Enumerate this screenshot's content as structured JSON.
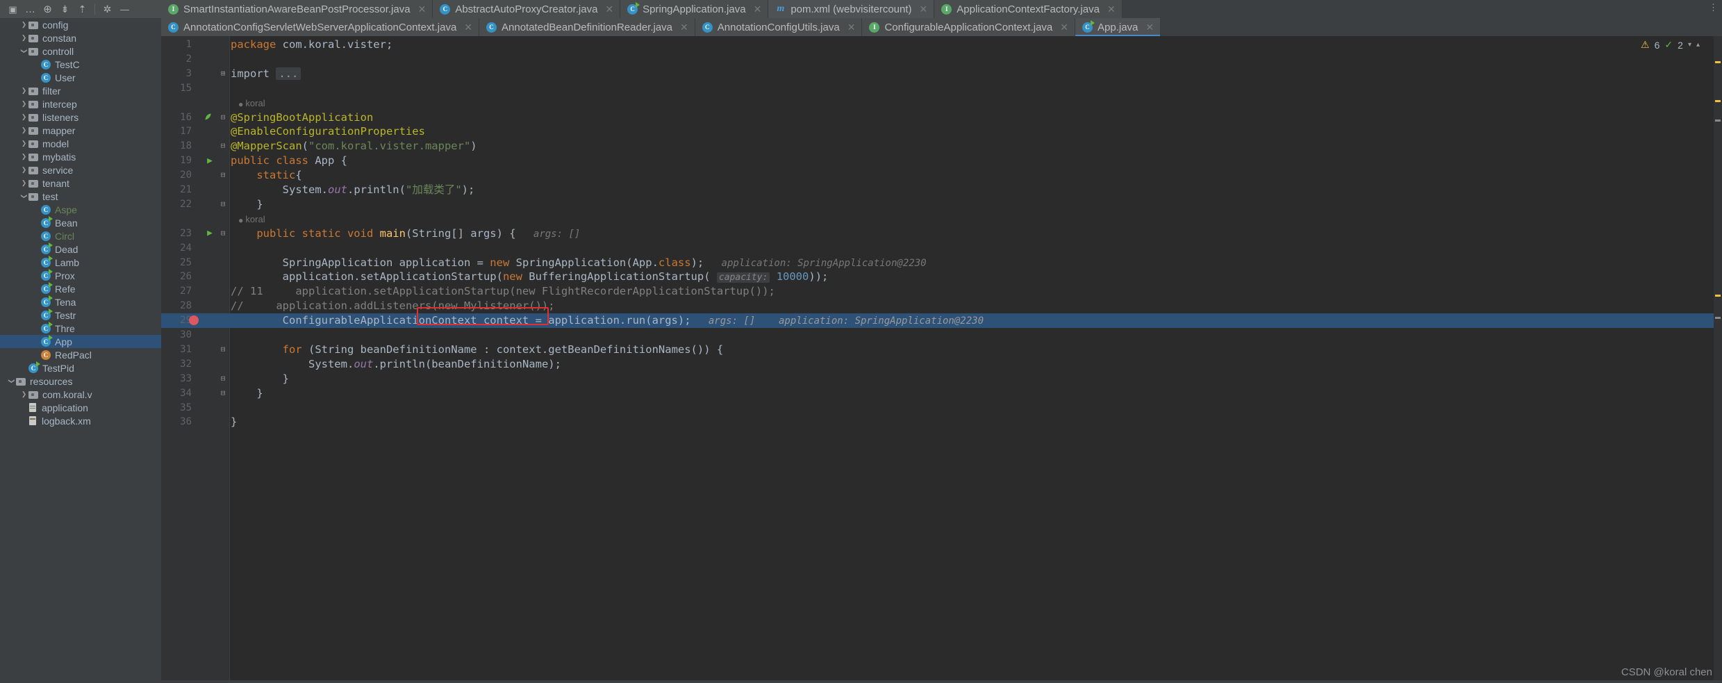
{
  "toolbar": {
    "icons": [
      {
        "name": "project-view-icon",
        "glyph": "▣"
      },
      {
        "name": "more-options-icon",
        "glyph": "…"
      },
      {
        "name": "locate-file-icon",
        "glyph": "⊕"
      },
      {
        "name": "expand-all-icon",
        "glyph": "⇟"
      },
      {
        "name": "collapse-all-icon",
        "glyph": "⇡"
      },
      {
        "name": "settings-gear-icon",
        "glyph": "✿"
      },
      {
        "name": "hide-panel-icon",
        "glyph": "—"
      }
    ]
  },
  "tabs_row1": [
    {
      "label": "SmartInstantiationAwareBeanPostProcessor.java",
      "icon": "interface",
      "state": "inactive"
    },
    {
      "label": "AbstractAutoProxyCreator.java",
      "icon": "class",
      "state": "inactive"
    },
    {
      "label": "SpringApplication.java",
      "icon": "class-runnable",
      "state": "inactive"
    },
    {
      "label": "pom.xml (webvisitercount)",
      "icon": "maven",
      "state": "active"
    },
    {
      "label": "ApplicationContextFactory.java",
      "icon": "interface",
      "state": "inactive"
    }
  ],
  "tabs_row2": [
    {
      "label": "AnnotationConfigServletWebServerApplicationContext.java",
      "icon": "class",
      "state": "inactive"
    },
    {
      "label": "AnnotatedBeanDefinitionReader.java",
      "icon": "class",
      "state": "inactive"
    },
    {
      "label": "AnnotationConfigUtils.java",
      "icon": "class",
      "state": "inactive"
    },
    {
      "label": "ConfigurableApplicationContext.java",
      "icon": "interface",
      "state": "inactive"
    },
    {
      "label": "App.java",
      "icon": "class-runnable",
      "state": "selected"
    }
  ],
  "tab_close_glyph": "✕",
  "tab_overflow_glyph": "⋮",
  "sidebar": {
    "items": [
      {
        "label": "config",
        "type": "folder",
        "arrow": "collapsed",
        "indent": 1
      },
      {
        "label": "constan",
        "type": "folder",
        "arrow": "collapsed",
        "indent": 1
      },
      {
        "label": "controll",
        "type": "folder",
        "arrow": "expanded",
        "indent": 1
      },
      {
        "label": "TestC",
        "type": "class",
        "arrow": "none",
        "indent": 2
      },
      {
        "label": "User",
        "type": "class",
        "arrow": "none",
        "indent": 2
      },
      {
        "label": "filter",
        "type": "folder",
        "arrow": "collapsed",
        "indent": 1
      },
      {
        "label": "intercep",
        "type": "folder",
        "arrow": "collapsed",
        "indent": 1
      },
      {
        "label": "listeners",
        "type": "folder",
        "arrow": "collapsed",
        "indent": 1
      },
      {
        "label": "mapper",
        "type": "folder",
        "arrow": "collapsed",
        "indent": 1
      },
      {
        "label": "model",
        "type": "folder",
        "arrow": "collapsed",
        "indent": 1
      },
      {
        "label": "mybatis",
        "type": "folder",
        "arrow": "collapsed",
        "indent": 1
      },
      {
        "label": "service",
        "type": "folder",
        "arrow": "collapsed",
        "indent": 1
      },
      {
        "label": "tenant",
        "type": "folder",
        "arrow": "collapsed",
        "indent": 1
      },
      {
        "label": "test",
        "type": "folder",
        "arrow": "expanded",
        "indent": 1
      },
      {
        "label": "Aspe",
        "type": "class",
        "arrow": "none",
        "indent": 2,
        "color": "green"
      },
      {
        "label": "Bean",
        "type": "class-runnable",
        "arrow": "none",
        "indent": 2
      },
      {
        "label": "Circl",
        "type": "class",
        "arrow": "none",
        "indent": 2,
        "color": "green"
      },
      {
        "label": "Dead",
        "type": "class-runnable",
        "arrow": "none",
        "indent": 2
      },
      {
        "label": "Lamb",
        "type": "class-runnable",
        "arrow": "none",
        "indent": 2
      },
      {
        "label": "Prox",
        "type": "class-runnable",
        "arrow": "none",
        "indent": 2
      },
      {
        "label": "Refe",
        "type": "class-runnable",
        "arrow": "none",
        "indent": 2
      },
      {
        "label": "Tena",
        "type": "class-runnable",
        "arrow": "none",
        "indent": 2
      },
      {
        "label": "Testr",
        "type": "class-runnable",
        "arrow": "none",
        "indent": 2
      },
      {
        "label": "Thre",
        "type": "class-runnable",
        "arrow": "none",
        "indent": 2
      },
      {
        "label": "App",
        "type": "class-runnable",
        "arrow": "none",
        "indent": 2,
        "selected": true
      },
      {
        "label": "RedPacl",
        "type": "class-other",
        "arrow": "none",
        "indent": 2
      },
      {
        "label": "TestPid",
        "type": "class-runnable",
        "arrow": "none",
        "indent": 1
      },
      {
        "label": "resources",
        "type": "folder-res",
        "arrow": "expanded",
        "indent": 0
      },
      {
        "label": "com.koral.v",
        "type": "folder",
        "arrow": "collapsed",
        "indent": 1
      },
      {
        "label": "application",
        "type": "properties",
        "arrow": "none",
        "indent": 1
      },
      {
        "label": "logback.xm",
        "type": "xml",
        "arrow": "none",
        "indent": 1
      }
    ]
  },
  "inspection_widget": {
    "warning_count": "6",
    "warning_icon": "warning-triangle-icon",
    "ok_count": "2",
    "ok_icon": "checkmark-icon",
    "chevron": "⌄"
  },
  "editor": {
    "lines": [
      {
        "num": "1",
        "fold": "",
        "tokens": [
          {
            "t": "package",
            "c": "kw"
          },
          {
            "t": " com.koral.vister;",
            "c": ""
          }
        ]
      },
      {
        "num": "2",
        "fold": "",
        "tokens": []
      },
      {
        "num": "3",
        "fold": "⊞",
        "tokens": [
          {
            "t": "import ",
            "c": ""
          },
          {
            "t": "...",
            "c": "foldchip"
          }
        ]
      },
      {
        "num": "15",
        "fold": "",
        "tokens": []
      },
      {
        "num": "",
        "fold": "",
        "author": "koral"
      },
      {
        "num": "16",
        "fold": "⊟",
        "bean": true,
        "tokens": [
          {
            "t": "@SpringBootApplication",
            "c": "ann"
          }
        ]
      },
      {
        "num": "17",
        "fold": "",
        "tokens": [
          {
            "t": "@EnableConfigurationProperties",
            "c": "ann"
          }
        ]
      },
      {
        "num": "18",
        "fold": "⊟",
        "tokens": [
          {
            "t": "@MapperScan",
            "c": "ann"
          },
          {
            "t": "(",
            "c": ""
          },
          {
            "t": "\"com.koral.vister.mapper\"",
            "c": "str"
          },
          {
            "t": ")",
            "c": ""
          }
        ]
      },
      {
        "num": "19",
        "fold": "",
        "run": true,
        "tokens": [
          {
            "t": "public class ",
            "c": "kw"
          },
          {
            "t": "App {",
            "c": ""
          }
        ]
      },
      {
        "num": "20",
        "fold": "⊟",
        "tokens": [
          {
            "t": "    static",
            "c": "kw"
          },
          {
            "t": "{",
            "c": ""
          }
        ]
      },
      {
        "num": "21",
        "fold": "",
        "tokens": [
          {
            "t": "        System.",
            "c": ""
          },
          {
            "t": "out",
            "c": "fld"
          },
          {
            "t": ".println(",
            "c": ""
          },
          {
            "t": "\"加载类了\"",
            "c": "str"
          },
          {
            "t": ");",
            "c": ""
          }
        ]
      },
      {
        "num": "22",
        "fold": "⊟",
        "tokens": [
          {
            "t": "    }",
            "c": ""
          }
        ]
      },
      {
        "num": "",
        "fold": "",
        "author": "koral"
      },
      {
        "num": "23",
        "fold": "⊟",
        "run": true,
        "tokens": [
          {
            "t": "    public static void ",
            "c": "kw"
          },
          {
            "t": "main",
            "c": "mth"
          },
          {
            "t": "(String[] args) {",
            "c": ""
          },
          {
            "t": "   args: []",
            "c": "hint"
          }
        ]
      },
      {
        "num": "24",
        "fold": "",
        "tokens": []
      },
      {
        "num": "25",
        "fold": "",
        "tokens": [
          {
            "t": "        SpringApplication application = ",
            "c": ""
          },
          {
            "t": "new ",
            "c": "kw"
          },
          {
            "t": "SpringApplication(App.",
            "c": ""
          },
          {
            "t": "class",
            "c": "kw"
          },
          {
            "t": ");",
            "c": ""
          },
          {
            "t": "   application: SpringApplication@2230",
            "c": "hint"
          }
        ]
      },
      {
        "num": "26",
        "fold": "",
        "tokens": [
          {
            "t": "        application.setApplicationStartup(",
            "c": ""
          },
          {
            "t": "new ",
            "c": "kw"
          },
          {
            "t": "BufferingApplicationStartup( ",
            "c": ""
          },
          {
            "t": "capacity:",
            "c": "pchip"
          },
          {
            "t": " ",
            "c": ""
          },
          {
            "t": "10000",
            "c": "num"
          },
          {
            "t": "));",
            "c": ""
          }
        ]
      },
      {
        "num": "27",
        "fold": "",
        "tokens": [
          {
            "t": "// 11     application.setApplicationStartup(new FlightRecorderApplicationStartup());",
            "c": "cmt"
          }
        ]
      },
      {
        "num": "28",
        "fold": "",
        "tokens": [
          {
            "t": "//     application.addListeners(new Mylistener());",
            "c": "cmt"
          }
        ]
      },
      {
        "num": "29",
        "fold": "",
        "breakpoint": true,
        "caret": true,
        "tokens": [
          {
            "t": "        ConfigurableApplicationContext context = application.run(args);",
            "c": ""
          },
          {
            "t": "   args: []    application: SpringApplication@2230",
            "c": "hintbox"
          }
        ]
      },
      {
        "num": "30",
        "fold": "",
        "tokens": []
      },
      {
        "num": "31",
        "fold": "⊟",
        "tokens": [
          {
            "t": "        for ",
            "c": "kw"
          },
          {
            "t": "(String beanDefinitionName : context.getBeanDefinitionNames()) {",
            "c": ""
          }
        ]
      },
      {
        "num": "32",
        "fold": "",
        "tokens": [
          {
            "t": "            System.",
            "c": ""
          },
          {
            "t": "out",
            "c": "fld"
          },
          {
            "t": ".println(beanDefinitionName);",
            "c": ""
          }
        ]
      },
      {
        "num": "33",
        "fold": "⊟",
        "tokens": [
          {
            "t": "        }",
            "c": ""
          }
        ]
      },
      {
        "num": "34",
        "fold": "⊟",
        "tokens": [
          {
            "t": "    }",
            "c": ""
          }
        ]
      },
      {
        "num": "35",
        "fold": "",
        "tokens": []
      },
      {
        "num": "36",
        "fold": "",
        "tokens": [
          {
            "t": "}",
            "c": ""
          }
        ]
      }
    ],
    "annotation_box": {
      "label": "red-highlight-box"
    }
  },
  "watermark": "CSDN @koral chen",
  "colors": {
    "editor_bg": "#2b2b2b",
    "gutter_bg": "#313335",
    "panel_bg": "#3c3f41",
    "tab_bg": "#4a4d4e",
    "selection_blue": "#2d5177",
    "accent_red": "#e03030",
    "keyword_orange": "#cc7832",
    "string_green": "#6a8759",
    "annotation_yellow": "#bbb529",
    "number_blue": "#6897bb",
    "method_yellow": "#ffc66d",
    "field_purple": "#9876aa",
    "comment_gray": "#808080"
  }
}
